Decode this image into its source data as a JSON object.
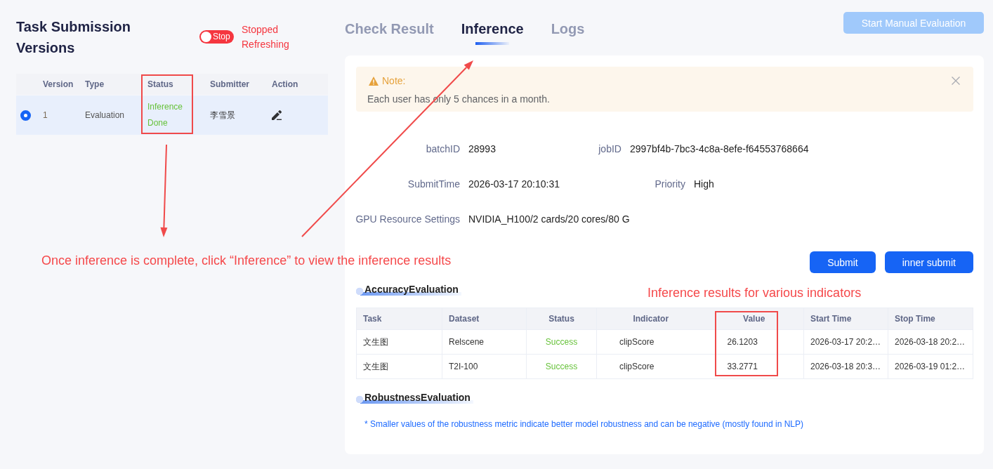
{
  "versions_panel": {
    "title": "Task Submission Versions",
    "refresh_toggle": {
      "label": "Stop",
      "on": false
    },
    "refresh_status": "Stopped Refreshing",
    "table": {
      "columns": [
        "Version",
        "Type",
        "Status",
        "Submitter",
        "Action"
      ],
      "rows": [
        {
          "selected": true,
          "version": "1",
          "type": "Evaluation",
          "status": "Inference Done",
          "submitter": "李雪景"
        }
      ]
    }
  },
  "tabs": [
    {
      "label": "Check Result",
      "selected": false
    },
    {
      "label": "Inference",
      "selected": true
    },
    {
      "label": "Logs",
      "selected": false
    }
  ],
  "header_button": {
    "label": "Start Manual Evaluation",
    "disabled": true
  },
  "note": {
    "title": "Note:",
    "text": "Each user has only 5 chances in a month."
  },
  "job_info": [
    [
      {
        "label": "batchID",
        "value": "28993"
      },
      {
        "label": "jobID",
        "value": "2997bf4b-7bc3-4c8a-8efe-f64553768664"
      }
    ],
    [
      {
        "label": "SubmitTime",
        "value": "2026-03-17 20:10:31"
      },
      {
        "label": "Priority",
        "value": "High"
      }
    ],
    [
      {
        "label": "GPU Resource Settings",
        "value": "NVIDIA_H100/2 cards/20 cores/80 G"
      }
    ]
  ],
  "actions": [
    "Submit",
    "inner submit"
  ],
  "accuracy": {
    "title": "AccuracyEvaluation",
    "columns": [
      {
        "label": "Task",
        "kind": "text"
      },
      {
        "label": "Dataset",
        "kind": "text"
      },
      {
        "label": "Status",
        "kind": "status"
      },
      {
        "label": "Indicator",
        "kind": "metric"
      },
      {
        "label": "Value",
        "kind": "metric"
      },
      {
        "label": "Start Time",
        "kind": "text"
      },
      {
        "label": "Stop Time",
        "kind": "text"
      }
    ],
    "rows": [
      [
        "文生图",
        "Relscene",
        "Success",
        "clipScore",
        "26.1203",
        "2026-03-17 20:2…",
        "2026-03-18 20:2…"
      ],
      [
        "文生图",
        "T2I-100",
        "Success",
        "clipScore",
        "33.2771",
        "2026-03-18 20:3…",
        "2026-03-19 01:2…"
      ]
    ]
  },
  "robustness": {
    "title": "RobustnessEvaluation",
    "note": "* Smaller values of the robustness metric indicate better model robustness and can be negative (mostly found in NLP)"
  },
  "callouts": [
    "Once inference is complete, click “Inference” to view the inference results",
    "Inference results for various indicators"
  ]
}
